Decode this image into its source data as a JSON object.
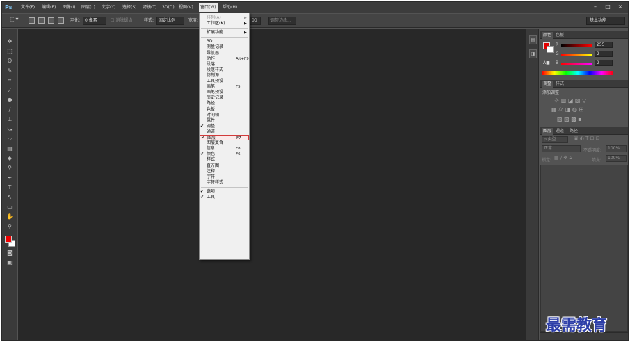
{
  "menubar": {
    "logo": "Ps",
    "items": [
      "文件(F)",
      "编辑(E)",
      "图像(I)",
      "图层(L)",
      "文字(Y)",
      "选择(S)",
      "滤镜(T)",
      "3D(D)",
      "视图(V)",
      "窗口(W)",
      "帮助(H)"
    ],
    "window_controls": [
      "–",
      "□",
      "×"
    ]
  },
  "options": {
    "feather_label": "羽化:",
    "feather_value": "0 像素",
    "antialias": "消除锯齿",
    "style_label": "样式:",
    "style_value": "固定比例",
    "width_label": "宽度:",
    "height_value": "00",
    "refine_edge": "调整边缘...",
    "workspace": "基本功能"
  },
  "dock": {
    "icon1": "历史",
    "icon2": "属性"
  },
  "window_menu": {
    "items": [
      {
        "label": "排列(A)",
        "disabled": true,
        "arrow": true
      },
      {
        "label": "工作区(K)",
        "arrow": true
      },
      {
        "sep": true
      },
      {
        "label": "扩展功能",
        "arrow": true
      },
      {
        "sep": true
      },
      {
        "label": "3D"
      },
      {
        "label": "测量记录"
      },
      {
        "label": "导航器"
      },
      {
        "label": "动作",
        "shortcut": "Alt+F9"
      },
      {
        "label": "段落"
      },
      {
        "label": "段落样式"
      },
      {
        "label": "仿制源"
      },
      {
        "label": "工具预设"
      },
      {
        "label": "画笔",
        "shortcut": "F5"
      },
      {
        "label": "画笔预设"
      },
      {
        "label": "历史记录"
      },
      {
        "label": "路径"
      },
      {
        "label": "色板"
      },
      {
        "label": "时间轴"
      },
      {
        "label": "属性"
      },
      {
        "label": "调整",
        "checked": true
      },
      {
        "label": "通道"
      },
      {
        "label": "图层",
        "shortcut": "F7",
        "checked": true,
        "highlight": true
      },
      {
        "label": "图层复合"
      },
      {
        "label": "信息",
        "shortcut": "F8"
      },
      {
        "label": "颜色",
        "shortcut": "F6",
        "checked": true
      },
      {
        "label": "样式"
      },
      {
        "label": "直方图"
      },
      {
        "label": "注释"
      },
      {
        "label": "字符"
      },
      {
        "label": "字符样式"
      },
      {
        "sep": true
      },
      {
        "label": "选项",
        "checked": true
      },
      {
        "label": "工具",
        "checked": true
      }
    ]
  },
  "color_panel": {
    "tabs": [
      "颜色",
      "色板"
    ],
    "r_label": "R",
    "g_label": "G",
    "b_label": "B",
    "r_value": "255",
    "g_value": "2",
    "b_value": "2",
    "foreground": "#e00000",
    "background": "#ffffff"
  },
  "adjust_panel": {
    "tabs": [
      "调整",
      "样式"
    ],
    "title": "添加调整"
  },
  "layers_panel": {
    "tabs": [
      "图层",
      "通道",
      "路径"
    ],
    "kind": "ρ 类型",
    "blend": "正常",
    "opacity_label": "不透明度:",
    "opacity": "100%",
    "lock_label": "锁定:",
    "fill_label": "填充:",
    "fill": "100%"
  },
  "watermark": "最需教育"
}
